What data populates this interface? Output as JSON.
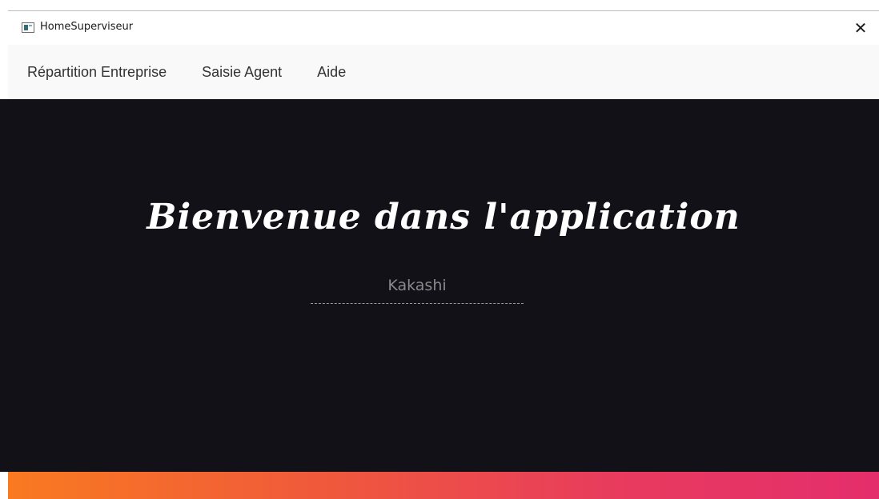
{
  "window": {
    "title": "HomeSuperviseur",
    "close_symbol": "✕"
  },
  "menu": {
    "items": [
      {
        "label": "Répartition Entreprise"
      },
      {
        "label": "Saisie Agent"
      },
      {
        "label": "Aide"
      }
    ]
  },
  "main": {
    "welcome": "Bienvenue dans l'application",
    "username": "Kakashi"
  },
  "icons": {
    "app": "window-app-icon",
    "close": "close-icon"
  },
  "colors": {
    "background": "#121118",
    "menubar": "#f9f9f9",
    "gradient_start": "#f97a21",
    "gradient_end": "#e42e6c"
  }
}
